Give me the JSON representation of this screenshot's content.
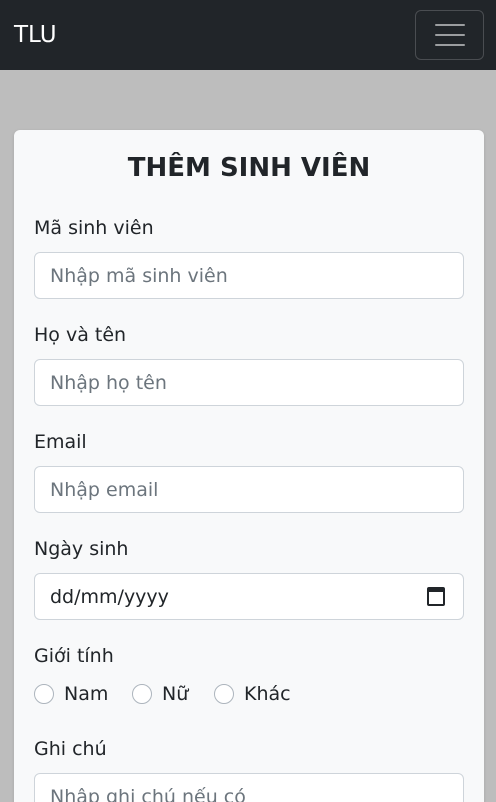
{
  "navbar": {
    "brand": "TLU",
    "toggler_icon": "hamburger-icon"
  },
  "form": {
    "title": "THÊM SINH VIÊN",
    "student_id": {
      "label": "Mã sinh viên",
      "placeholder": "Nhập mã sinh viên",
      "value": ""
    },
    "full_name": {
      "label": "Họ và tên",
      "placeholder": "Nhập họ tên",
      "value": ""
    },
    "email": {
      "label": "Email",
      "placeholder": "Nhập email",
      "value": ""
    },
    "dob": {
      "label": "Ngày sinh",
      "display": "dd/mm/yyyy",
      "icon": "calendar-icon"
    },
    "gender": {
      "label": "Giới tính",
      "options": [
        "Nam",
        "Nữ",
        "Khác"
      ],
      "selected": ""
    },
    "note": {
      "label": "Ghi chú",
      "placeholder": "Nhập ghi chú nếu có",
      "value": ""
    }
  }
}
